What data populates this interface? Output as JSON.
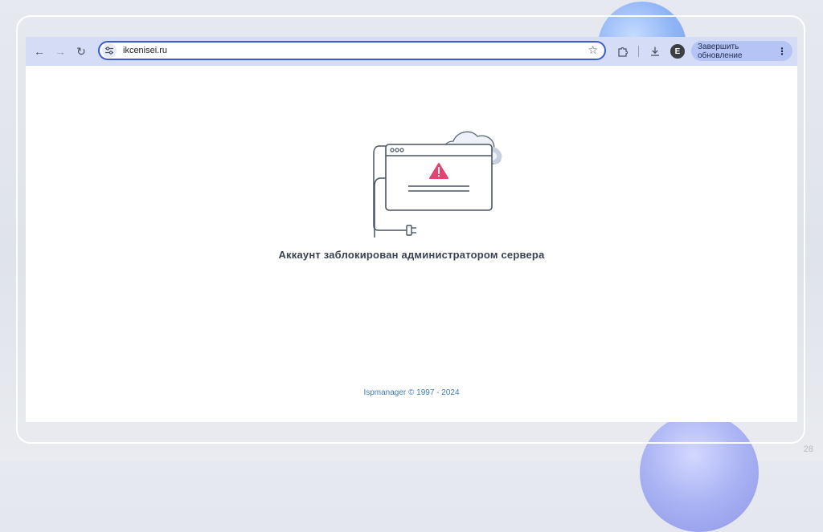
{
  "browser": {
    "url": "ikcenisei.ru",
    "update_button_label": "Завершить обновление",
    "profile_initial": "E"
  },
  "page": {
    "message": "Аккаунт заблокирован администратором сервера",
    "footer": "Ispmanager © 1997 - 2024"
  },
  "slide": {
    "number": "28"
  },
  "icons": {
    "back": "back-arrow-icon",
    "forward": "forward-arrow-icon",
    "reload": "reload-icon",
    "site_info": "tune-icon",
    "bookmark": "star-icon",
    "extensions": "puzzle-icon",
    "downloads": "download-icon",
    "menu": "more-vert-icon"
  },
  "colors": {
    "toolbar": "#d5dcf6",
    "omnibox_border": "#3b5bd1",
    "warning": "#e2446f",
    "footer_link": "#3d7cb8"
  }
}
